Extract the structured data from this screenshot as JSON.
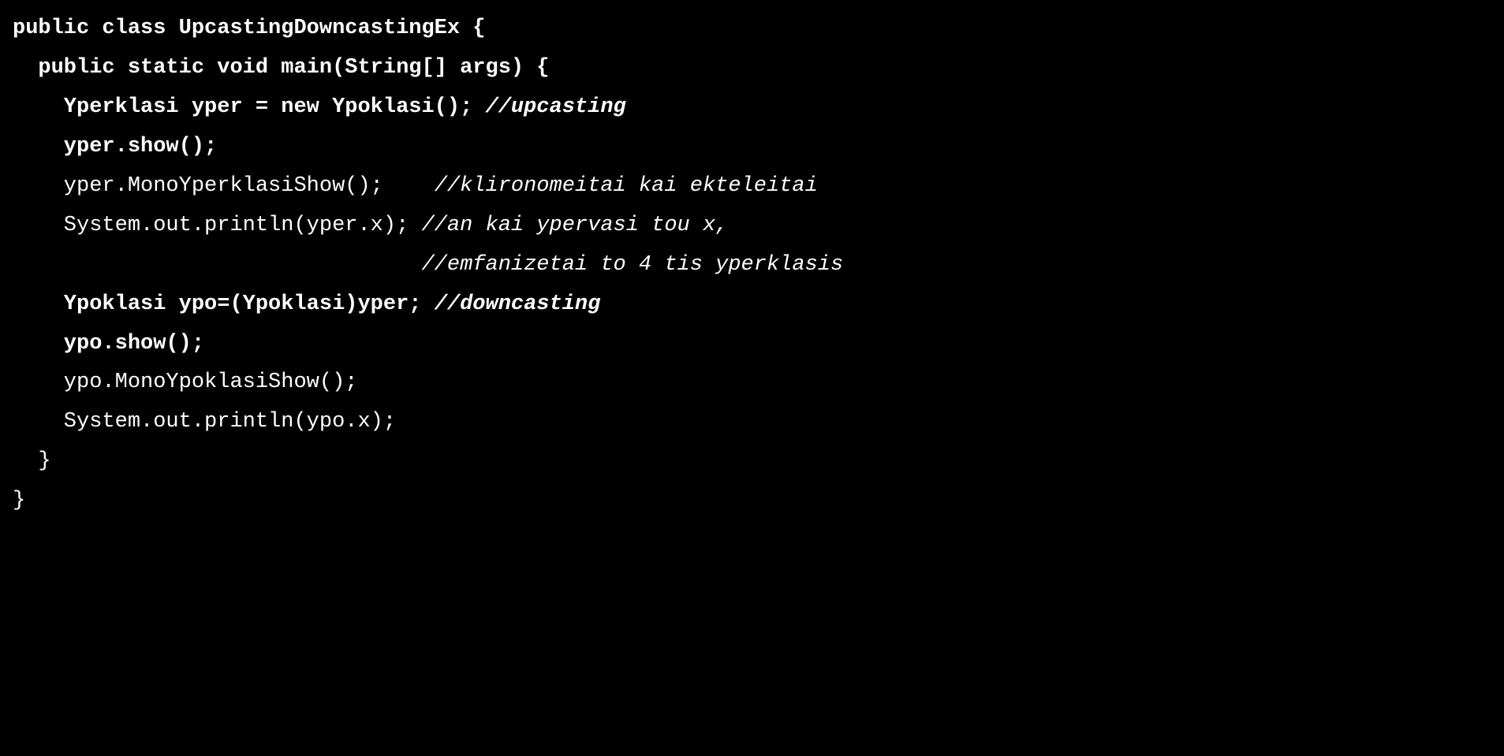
{
  "code": {
    "l1_classdecl": "public class UpcastingDowncastingEx {",
    "l2_main": "  public static void main(String[] args) {",
    "l3_a": "    Yperklasi yper = new Ypoklasi(); ",
    "l3_b": "//upcasting",
    "l4": "    yper.show();",
    "l5_a": "    yper.MonoYperklasiShow();    ",
    "l5_b": "//klironomeitai kai ekteleitai",
    "l6_a": "    System.out.println(yper.x); ",
    "l6_b": "//an kai ypervasi tou x,",
    "l7_pad": "                                ",
    "l7_b": "//emfanizetai to 4 tis yperklasis",
    "l8_a": "    Ypoklasi ypo=(Ypoklasi)yper; ",
    "l8_b": "//downcasting",
    "l9": "    ypo.show();",
    "l10": "    ypo.MonoYpoklasiShow();",
    "l11": "    System.out.println(ypo.x);",
    "l12": "  }",
    "l13": "}"
  }
}
